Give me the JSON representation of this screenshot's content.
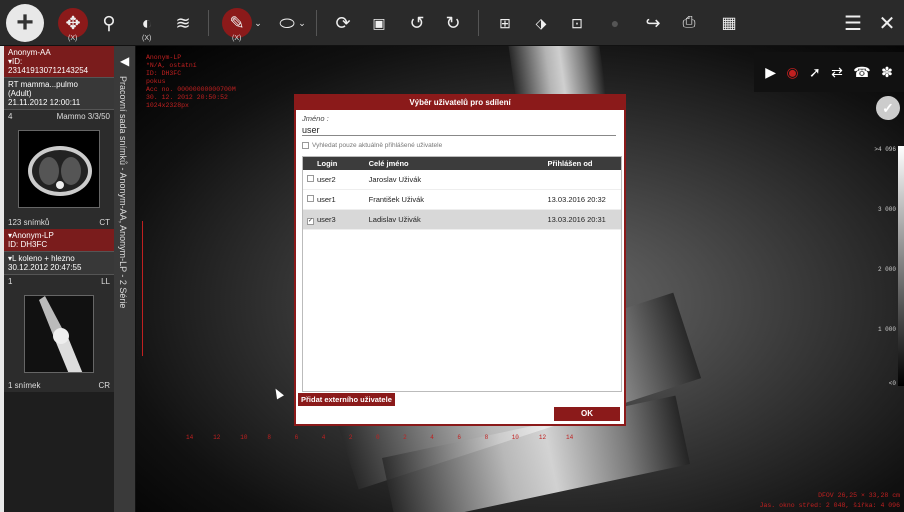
{
  "toolbar": {
    "add_icon": "plus-icon",
    "pan_sub": "(X)",
    "wl_sub": "(X)",
    "measure_sub": "(X)"
  },
  "left_panel": {
    "patient1": {
      "name": "Anonym-AA",
      "id_label": "ID:",
      "id_value": "231419130712143254",
      "study_title": "RT mamma...pulmo",
      "study_sub": "(Adult)",
      "study_date": "21.11.2012 12:00:11",
      "series_num": "4",
      "series_desc": "Mammo 3/3/50",
      "count": "123 snímků",
      "modality": "CT"
    },
    "patient2": {
      "name": "Anonym-LP",
      "id": "ID: DH3FC",
      "study_title": "L koleno + hlezno",
      "study_date": "30.12.2012 20:47:55",
      "series_num": "1",
      "series_desc": "LL",
      "count": "1 snímek",
      "modality": "CR"
    }
  },
  "series_strip": {
    "text": "Pracovní sada snímků - Anonym-AA, Anonym-LP - 2 Série"
  },
  "viewer": {
    "overlay_lines": "Anonym-LP\n*N/A, ostatní\nID: DH3FC\npokus\nAcc no. 00000000000700M\n30. 12. 2012 20:50:52\n1024x2328px",
    "scale_labels": [
      ">4 096",
      "3 000",
      "2 000",
      "1 000",
      "<0"
    ],
    "bottom_ruler": [
      "14",
      "12",
      "10",
      "8",
      "6",
      "4",
      "2",
      "0",
      "2",
      "4",
      "6",
      "8",
      "10",
      "12",
      "14"
    ],
    "bottom_right_1": "DFOV 26,25 × 33,28 cm",
    "bottom_right_2": "Jas. okno střed: 2 048, šířka: 4 096"
  },
  "modal": {
    "title": "Výběr uživatelů pro sdílení",
    "name_label": "Jméno :",
    "name_value": "user",
    "only_logged": "Vyhledat pouze aktuálně přihlášené uživatele",
    "col_login": "Login",
    "col_name": "Celé jméno",
    "col_date": "Přihlášen od",
    "rows": [
      {
        "login": "user2",
        "name": "Jaroslav Uživák",
        "date": "",
        "checked": ""
      },
      {
        "login": "user1",
        "name": "František Uživák",
        "date": "13.03.2016 20:32",
        "checked": ""
      },
      {
        "login": "user3",
        "name": "Ladislav Uživák",
        "date": "13.03.2016 20:31",
        "checked": "✓"
      }
    ],
    "add_external": "Přidat externího uživatele",
    "ok": "OK"
  },
  "colors": {
    "accent": "#8b1a1a",
    "overlay": "#c02020"
  }
}
